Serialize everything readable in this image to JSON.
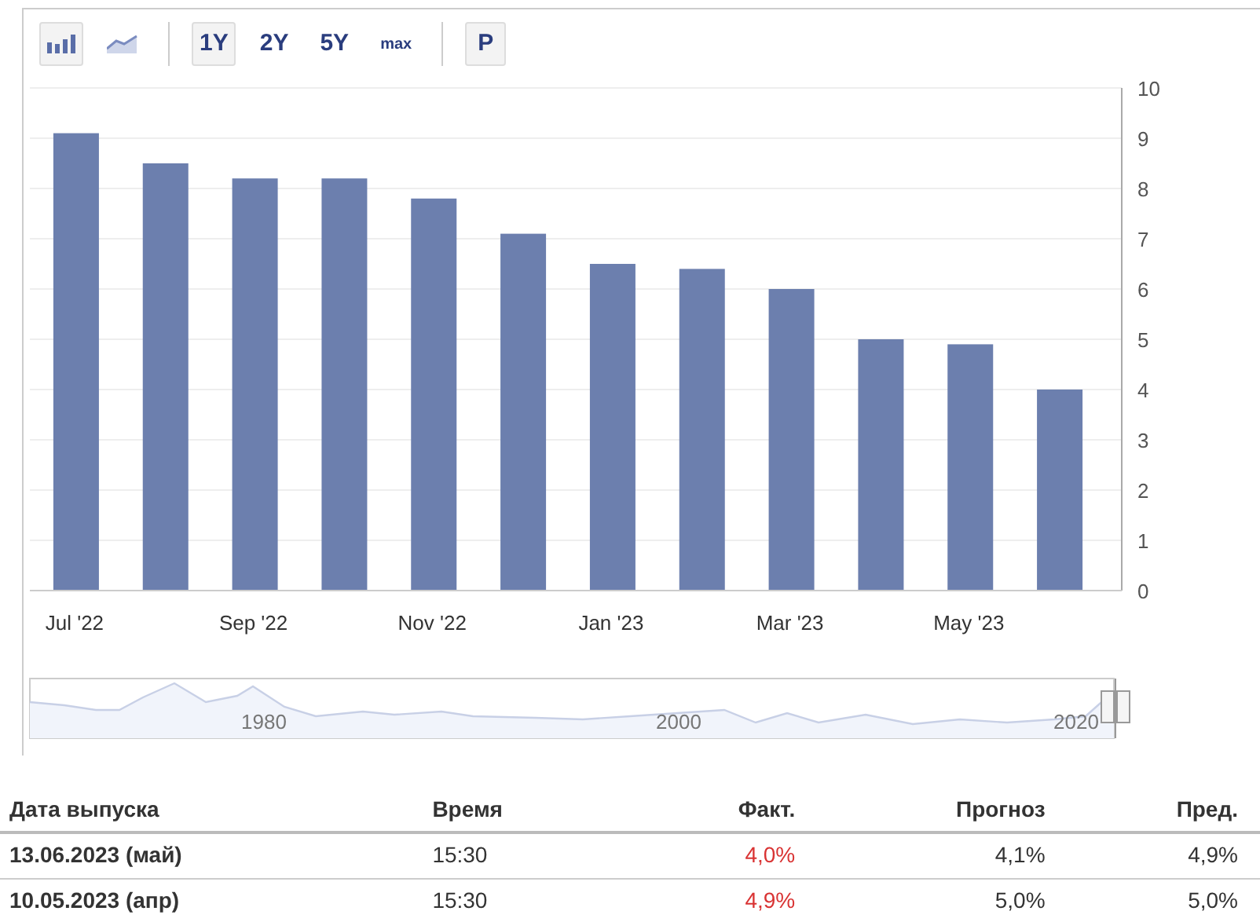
{
  "toolbar": [
    {
      "kind": "bar-icon",
      "selected": true
    },
    {
      "kind": "line-icon",
      "selected": false
    },
    {
      "kind": "separator"
    },
    {
      "kind": "text",
      "label": "1Y",
      "selected": true
    },
    {
      "kind": "text",
      "label": "2Y",
      "selected": false
    },
    {
      "kind": "text",
      "label": "5Y",
      "selected": false
    },
    {
      "kind": "small-text",
      "label": "max",
      "selected": false
    },
    {
      "kind": "separator"
    },
    {
      "kind": "text",
      "label": "P",
      "selected": true
    }
  ],
  "chart": {
    "chart_data": {
      "type": "bar",
      "categories": [
        "Jul '22",
        null,
        "Sep '22",
        null,
        "Nov '22",
        null,
        "Jan '23",
        null,
        "Mar '23",
        null,
        "May '23",
        null
      ],
      "series": [
        {
          "color": "#6c7fae",
          "values": [
            9.1,
            8.5,
            8.2,
            8.2,
            7.8,
            7.1,
            6.5,
            6.4,
            6.0,
            5.0,
            4.9,
            4.0
          ]
        }
      ],
      "grid": true,
      "ylim": [
        0,
        10
      ],
      "yticks": [
        0,
        1,
        2,
        3,
        4,
        5,
        6,
        7,
        8,
        9,
        10
      ]
    }
  },
  "navigator": {
    "labels": [
      "1980",
      "2000",
      "2020"
    ]
  },
  "table": {
    "columns": [
      "Дата выпуска",
      "Время",
      "Факт.",
      "Прогноз",
      "Пред."
    ],
    "rows": [
      {
        "date": "13.06.2023 (май)",
        "time": "15:30",
        "actual": "4,0%",
        "actual_negative": true,
        "forecast": "4,1%",
        "previous": "4,9%"
      },
      {
        "date": "10.05.2023 (апр)",
        "time": "15:30",
        "actual": "4,9%",
        "actual_negative": true,
        "forecast": "5,0%",
        "previous": "5,0%"
      }
    ]
  }
}
